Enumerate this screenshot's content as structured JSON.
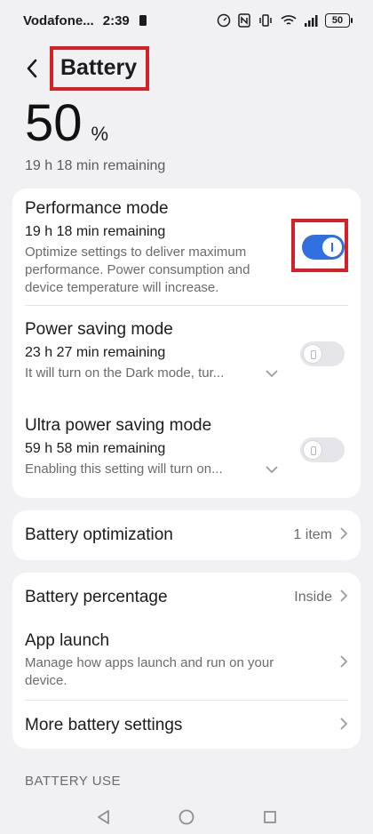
{
  "status_bar": {
    "carrier": "Vodafone...",
    "time": "2:39",
    "battery_level": "50"
  },
  "header": {
    "title": "Battery"
  },
  "battery": {
    "percent": "50",
    "percent_symbol": "%",
    "remaining": "19 h 18 min remaining"
  },
  "modes": [
    {
      "title": "Performance mode",
      "remaining": "19 h 18 min remaining",
      "description": "Optimize settings to deliver maximum performance. Power consumption and device temperature will increase.",
      "enabled": true
    },
    {
      "title": "Power saving mode",
      "remaining": "23 h 27 min remaining",
      "description": "It will turn on the Dark mode, tur...",
      "enabled": false
    },
    {
      "title": "Ultra power saving mode",
      "remaining": "59 h 58 min remaining",
      "description": "Enabling this setting will turn on...",
      "enabled": false
    }
  ],
  "optimization": {
    "label": "Battery optimization",
    "value": "1 item"
  },
  "settings": {
    "battery_percentage": {
      "label": "Battery percentage",
      "value": "Inside"
    },
    "app_launch": {
      "label": "App launch",
      "description": "Manage how apps launch and run on your device."
    },
    "more": {
      "label": "More battery settings"
    }
  },
  "section": {
    "battery_use": "BATTERY USE"
  },
  "colors": {
    "accent": "#2f6fe0",
    "highlight": "#d61f26",
    "background": "#f1f1f3"
  }
}
